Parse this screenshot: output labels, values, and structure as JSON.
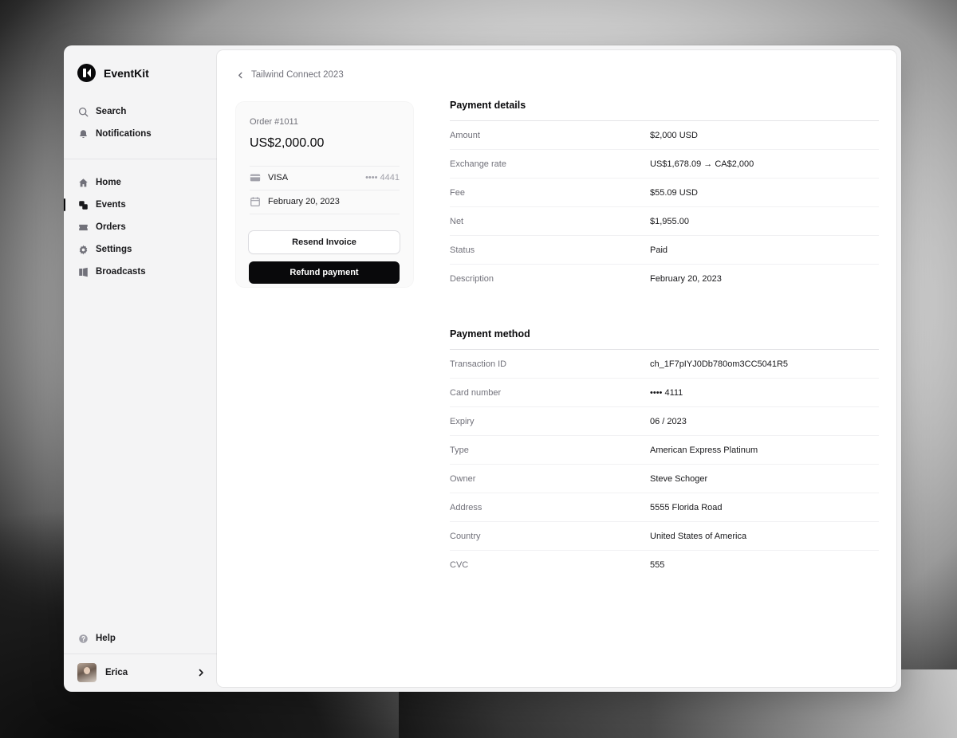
{
  "app": {
    "name": "EventKit"
  },
  "sidebar": {
    "top": [
      {
        "label": "Search",
        "icon": "search-icon"
      },
      {
        "label": "Notifications",
        "icon": "bell-icon"
      }
    ],
    "main": [
      {
        "label": "Home",
        "icon": "home-icon"
      },
      {
        "label": "Events",
        "icon": "events-icon",
        "active": true
      },
      {
        "label": "Orders",
        "icon": "ticket-icon"
      },
      {
        "label": "Settings",
        "icon": "gear-icon"
      },
      {
        "label": "Broadcasts",
        "icon": "megaphone-icon"
      }
    ],
    "help": {
      "label": "Help",
      "icon": "help-icon"
    },
    "user": {
      "name": "Erica"
    }
  },
  "breadcrumb": {
    "label": "Tailwind Connect 2023"
  },
  "order": {
    "label": "Order #1011",
    "amount": "US$2,000.00",
    "card_brand": "VISA",
    "card_masked": "•••• 4441",
    "date": "February 20, 2023",
    "resend_label": "Resend Invoice",
    "refund_label": "Refund payment"
  },
  "payment_details": {
    "title": "Payment details",
    "rows": [
      {
        "label": "Amount",
        "value": "$2,000 USD"
      },
      {
        "label": "Exchange rate",
        "value": "US$1,678.09 → CA$2,000"
      },
      {
        "label": "Fee",
        "value": "$55.09 USD"
      },
      {
        "label": "Net",
        "value": "$1,955.00"
      },
      {
        "label": "Status",
        "value": "Paid"
      },
      {
        "label": "Description",
        "value": "February 20, 2023"
      }
    ]
  },
  "payment_method": {
    "title": "Payment method",
    "rows": [
      {
        "label": "Transaction ID",
        "value": "ch_1F7pIYJ0Db780om3CC5041R5"
      },
      {
        "label": "Card number",
        "value": "•••• 4111"
      },
      {
        "label": "Expiry",
        "value": "06 / 2023"
      },
      {
        "label": "Type",
        "value": "American Express Platinum"
      },
      {
        "label": "Owner",
        "value": "Steve Schoger"
      },
      {
        "label": "Address",
        "value": "5555 Florida Road"
      },
      {
        "label": "Country",
        "value": "United States of America"
      },
      {
        "label": "CVC",
        "value": "555"
      }
    ]
  }
}
